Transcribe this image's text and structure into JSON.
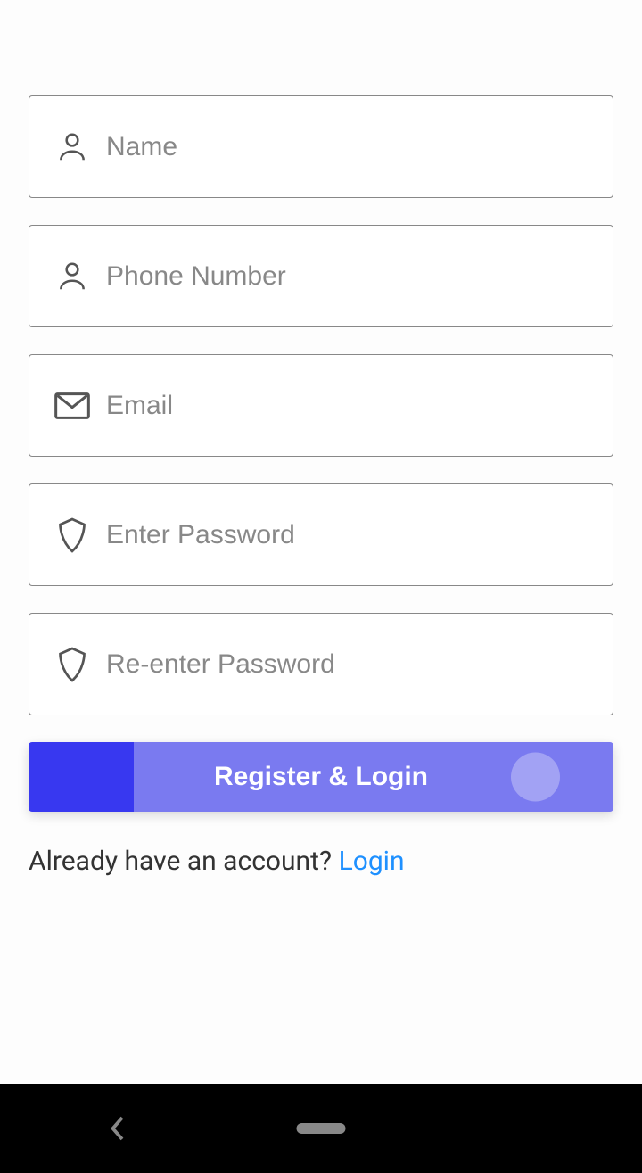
{
  "form": {
    "name": {
      "placeholder": "Name",
      "value": ""
    },
    "phone": {
      "placeholder": "Phone Number",
      "value": ""
    },
    "email": {
      "placeholder": "Email",
      "value": ""
    },
    "password": {
      "placeholder": "Enter Password",
      "value": ""
    },
    "confirm_password": {
      "placeholder": "Re-enter Password",
      "value": ""
    }
  },
  "register_button": "Register & Login",
  "footer": {
    "prompt": "Already have an account? ",
    "login_link": "Login"
  }
}
